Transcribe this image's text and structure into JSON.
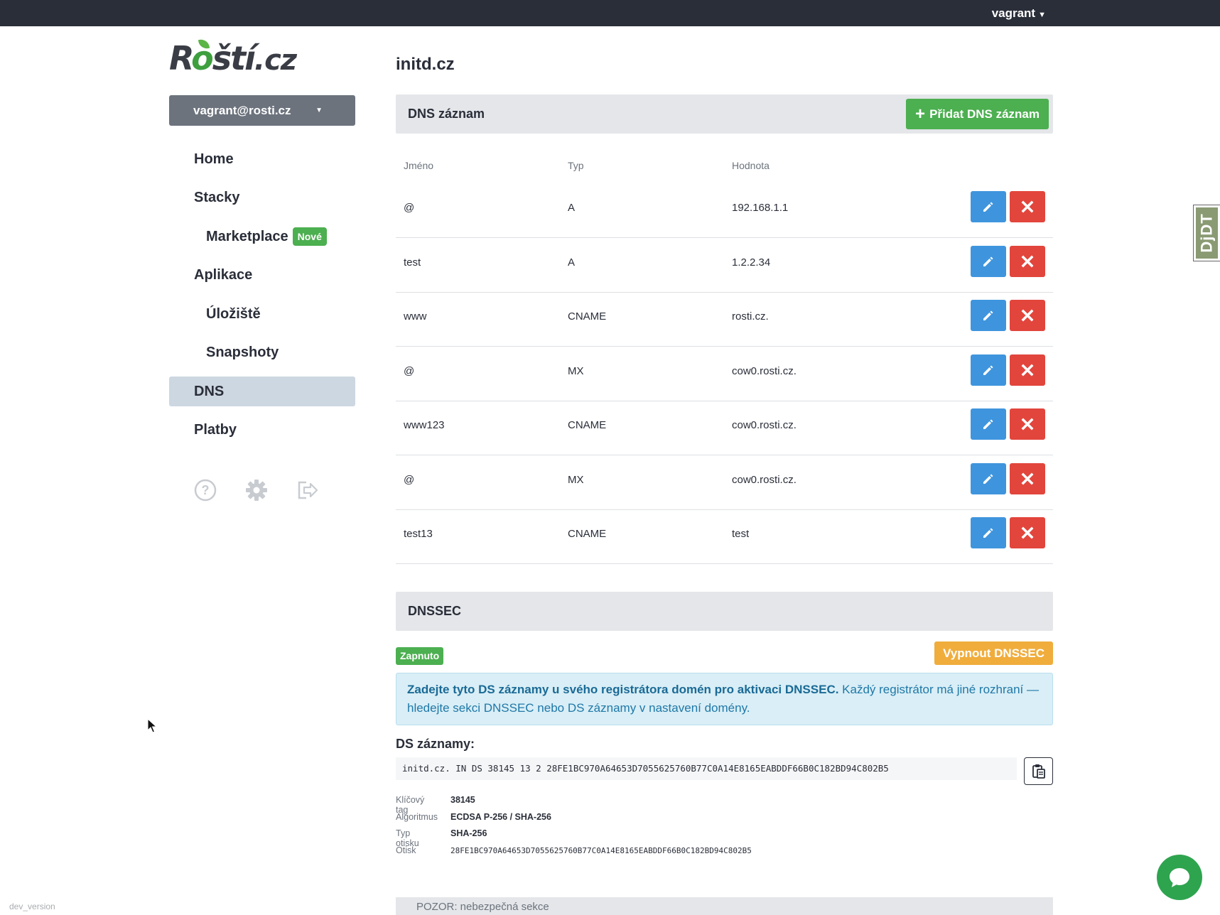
{
  "topbar": {
    "user": "vagrant"
  },
  "logo": {
    "prefix": "R",
    "o": "o",
    "rest": "ští",
    "suffix": ".cz"
  },
  "sidebar": {
    "account": "vagrant@rosti.cz",
    "items": [
      {
        "label": "Home",
        "sub": false,
        "active": false
      },
      {
        "label": "Stacky",
        "sub": false,
        "active": false
      },
      {
        "label": "Marketplace",
        "sub": true,
        "active": false,
        "badge": "Nové"
      },
      {
        "label": "Aplikace",
        "sub": false,
        "active": false
      },
      {
        "label": "Úložiště",
        "sub": true,
        "active": false
      },
      {
        "label": "Snapshoty",
        "sub": true,
        "active": false
      },
      {
        "label": "DNS",
        "sub": false,
        "active": true
      },
      {
        "label": "Platby",
        "sub": false,
        "active": false
      }
    ],
    "icons": [
      "help-icon",
      "gear-icon",
      "logout-icon"
    ]
  },
  "main": {
    "title": "initd.cz",
    "dns_header": "DNS záznam",
    "add_button": "Přidat DNS záznam",
    "columns": {
      "name": "Jméno",
      "type": "Typ",
      "value": "Hodnota"
    },
    "records": [
      {
        "name": "@",
        "type": "A",
        "value": "192.168.1.1"
      },
      {
        "name": "test",
        "type": "A",
        "value": "1.2.2.34"
      },
      {
        "name": "www",
        "type": "CNAME",
        "value": "rosti.cz."
      },
      {
        "name": "@",
        "type": "MX",
        "value": "cow0.rosti.cz."
      },
      {
        "name": "www123",
        "type": "CNAME",
        "value": "cow0.rosti.cz."
      },
      {
        "name": "@",
        "type": "MX",
        "value": "cow0.rosti.cz."
      },
      {
        "name": "test13",
        "type": "CNAME",
        "value": "test"
      }
    ],
    "dnssec": {
      "header": "DNSSEC",
      "status": "Zapnuto",
      "disable_button": "Vypnout DNSSEC",
      "info_bold": "Zadejte tyto DS záznamy u svého registrátora domén pro aktivaci DNSSEC.",
      "info_rest": " Každý registrátor má jiné rozhraní — hledejte sekci DNSSEC nebo DS záznamy v nastavení domény.",
      "ds_title": "DS záznamy:",
      "ds_record": "initd.cz. IN DS 38145 13 2 28FE1BC970A64653D7055625760B77C0A14E8165EABDDF66B0C182BD94C802B5",
      "meta": [
        {
          "key": "Klíčový tag",
          "value": "38145",
          "mono": false
        },
        {
          "key": "Algoritmus",
          "value": "ECDSA P-256 / SHA-256",
          "mono": false
        },
        {
          "key": "Typ otisku",
          "value": "SHA-256",
          "mono": false
        },
        {
          "key": "Otisk",
          "value": "28FE1BC970A64653D7055625760B77C0A14E8165EABDDF66B0C182BD94C802B5",
          "mono": true
        }
      ]
    },
    "danger": "POZOR: nebezpečná sekce"
  },
  "footer": {
    "dev_version": "dev_version"
  },
  "djdt": "DjDT",
  "colors": {
    "primary": "#3f95dd",
    "danger": "#e2453c",
    "success": "#4caf50",
    "warning": "#f0ad3c",
    "dark": "#2a2e39"
  }
}
